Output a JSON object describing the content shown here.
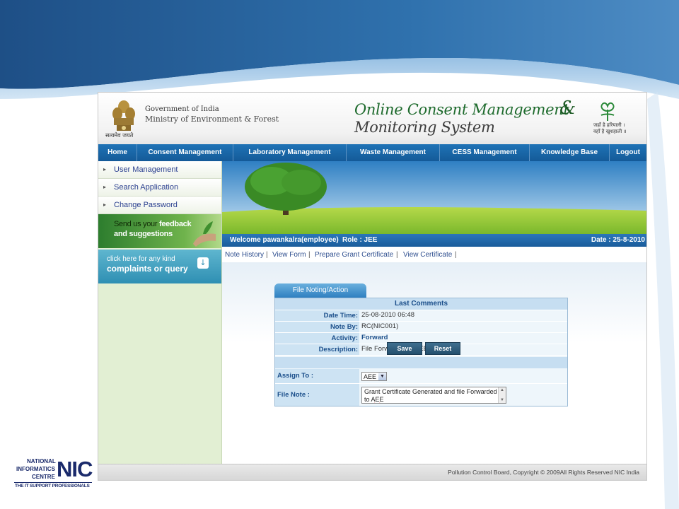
{
  "header": {
    "gov_title": "Government of India",
    "ministry": "Ministry of Environment & Forest",
    "motto": "सत्यमेव जयते",
    "app_title_line1": "Online Consent Management",
    "app_title_amp": "&",
    "app_title_line2": "Monitoring System",
    "tagline_line1": "जहाँ है हरियाली ।",
    "tagline_line2": "वहाँ है खुशहाली ॥"
  },
  "nav": {
    "items": [
      {
        "label": "Home"
      },
      {
        "label": "Consent Management"
      },
      {
        "label": "Laboratory Management"
      },
      {
        "label": "Waste Management"
      },
      {
        "label": "CESS Management"
      },
      {
        "label": "Knowledge Base"
      },
      {
        "label": "Logout"
      }
    ]
  },
  "sidebar": {
    "items": [
      {
        "label": "User Management"
      },
      {
        "label": "Search Application"
      },
      {
        "label": "Change Password"
      }
    ],
    "feedback_line1_prefix": "Send us your ",
    "feedback_line1_bold": "feedback",
    "feedback_line2": "and suggestions",
    "complaint_line1": "click here for any kind",
    "complaint_line2": "complaints or query"
  },
  "welcome_bar": {
    "welcome": "Welcome pawankalra(employee)",
    "role": "Role : JEE",
    "date": "Date : 25-8-2010"
  },
  "links": [
    {
      "label": "Note History"
    },
    {
      "label": "View Form"
    },
    {
      "label": "Prepare Grant Certificate"
    },
    {
      "label": "View Certificate"
    }
  ],
  "link_separator": "|",
  "form": {
    "tab_label": "File Noting/Action",
    "last_comments_title": "Last Comments",
    "rows": [
      {
        "label": "Date Time:",
        "value": "25-08-2010 06:48"
      },
      {
        "label": "Note By:",
        "value": "RC(NIC001)"
      },
      {
        "label": "Activity:",
        "value": "Forward"
      },
      {
        "label": "Description:",
        "value": "File Forwarded to JEE"
      }
    ],
    "assign_label": "Assign To :",
    "assign_value": "AEE",
    "file_note_label": "File Note :",
    "file_note_value_part1": "Grant Certificate Generated and file Forwarded to ",
    "file_note_value_part2": "AEE",
    "save_label": "Save",
    "reset_label": "Reset"
  },
  "footer": {
    "copyright": "Pollution Control Board, Copyright © 2009All Rights Reserved NIC India"
  },
  "nic_logo": {
    "line1": "NATIONAL",
    "line2": "INFORMATICS",
    "line3": "CENTRE",
    "big": "NIC",
    "line4": "THE IT SUPPORT PROFESSIONALS"
  },
  "colors": {
    "nav_blue": "#1a66a8",
    "sidebar_green": "#e2efd3",
    "title_green": "#1d6a2c",
    "label_blue": "#1a4e8a"
  }
}
